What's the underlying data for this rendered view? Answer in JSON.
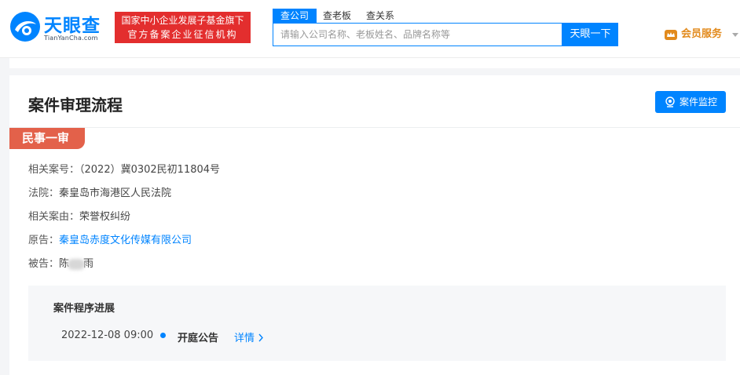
{
  "header": {
    "logo_cn": "天眼查",
    "logo_en": "TianYanCha.com",
    "slogan_line1": "国家中小企业发展子基金旗下",
    "slogan_line2": "官方备案企业征信机构",
    "search_tabs": [
      "查公司",
      "查老板",
      "查关系"
    ],
    "search_placeholder": "请输入公司名称、老板姓名、品牌名称等",
    "search_button": "天眼一下",
    "vip_label": "会员服务"
  },
  "card": {
    "title": "案件审理流程",
    "monitor_button": "案件监控",
    "stage_tag": "民事一审",
    "rows": {
      "case_no_label": "相关案号：",
      "case_no_value": "（2022）冀0302民初11804号",
      "court_label": "法院：",
      "court_value": "秦皇岛市海港区人民法院",
      "cause_label": "相关案由：",
      "cause_value": "荣誉权纠纷",
      "plaintiff_label": "原告：",
      "plaintiff_value": "秦皇岛赤度文化传媒有限公司",
      "defendant_label": "被告：",
      "defendant_first": "陈",
      "defendant_last": "雨"
    },
    "progress": {
      "title": "案件程序进展",
      "time": "2022-12-08 09:00",
      "event": "开庭公告",
      "detail_link": "详情"
    }
  },
  "colors": {
    "brand_blue": "#0084ff",
    "slogan_red": "#e32e2e",
    "stage_red": "#e3614a",
    "vip_orange": "#e28a1c"
  },
  "icons": [
    "tianyancha-logo-icon",
    "crown-icon",
    "monitor-eye-icon",
    "chevron-right-icon",
    "chevron-down-icon"
  ]
}
